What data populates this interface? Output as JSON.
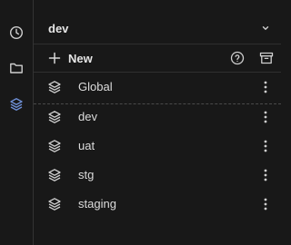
{
  "sidebar": {
    "items": [
      {
        "name": "history",
        "icon": "clock-icon"
      },
      {
        "name": "folders",
        "icon": "folder-icon"
      },
      {
        "name": "environments",
        "icon": "layers-icon",
        "active": true
      }
    ],
    "active_color": "#6e8fd6"
  },
  "env_selector": {
    "value": "dev",
    "icon": "chevron-down-icon"
  },
  "toolbar": {
    "new_label": "New",
    "new_icon": "plus-icon",
    "help_icon": "help-circle-icon",
    "archive_icon": "archive-icon"
  },
  "global_env": {
    "label": "Global",
    "icon": "layers-icon",
    "menu_icon": "more-vertical-icon"
  },
  "environments": [
    {
      "label": "dev",
      "icon": "layers-icon",
      "menu_icon": "more-vertical-icon"
    },
    {
      "label": "uat",
      "icon": "layers-icon",
      "menu_icon": "more-vertical-icon"
    },
    {
      "label": "stg",
      "icon": "layers-icon",
      "menu_icon": "more-vertical-icon"
    },
    {
      "label": "staging",
      "icon": "layers-icon",
      "menu_icon": "more-vertical-icon"
    }
  ],
  "colors": {
    "background": "#181818",
    "top_accent": "#1c8a5e",
    "text": "#e4e4e4",
    "icon": "#cfcfcf"
  }
}
